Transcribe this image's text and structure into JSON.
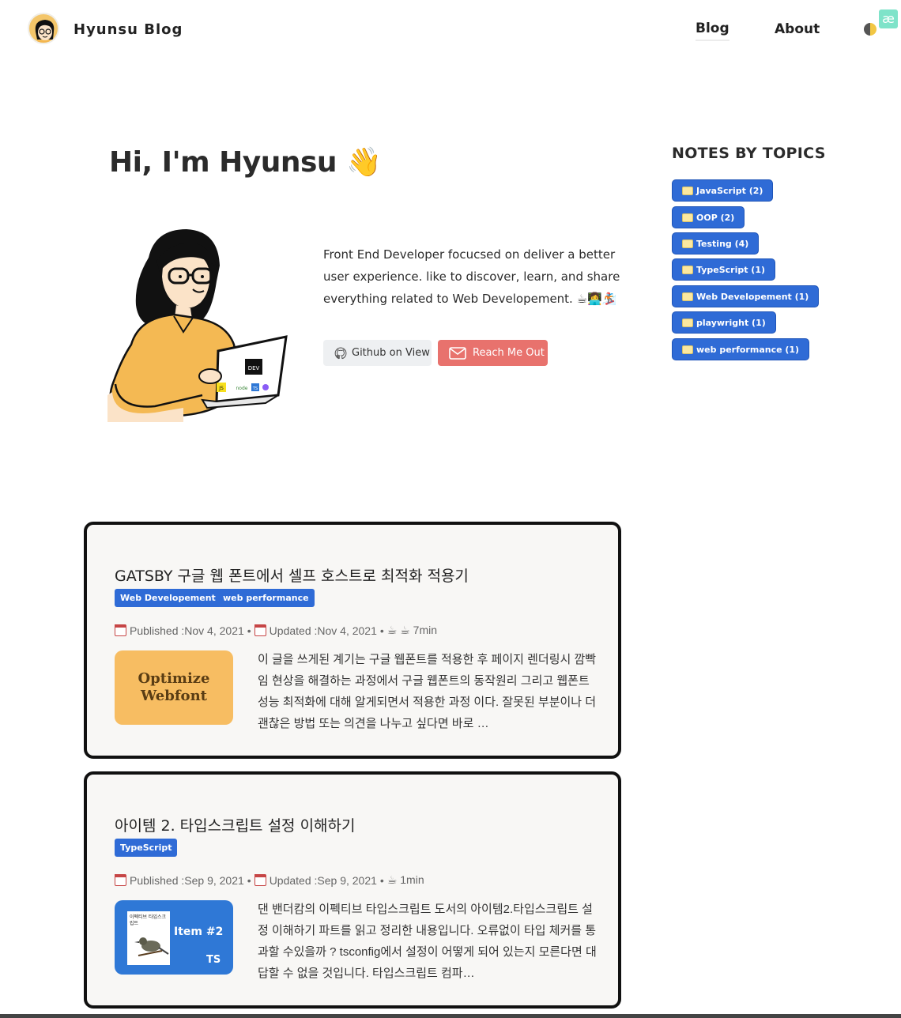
{
  "header": {
    "site_title": "Hyunsu Blog",
    "nav": {
      "blog": "Blog",
      "about": "About"
    },
    "ae_badge": "æ"
  },
  "hero": {
    "title": "Hi, I'm Hyunsu 👋",
    "bio": "Front End Developer focucsed on deliver a better user experience. like to discover, learn, and share everything related to Web Developement. ☕👩‍💻🏂",
    "github_button": "Github on View",
    "reach_button": "Reach Me Out",
    "laptop_sticker": "DEV",
    "laptop_logos": [
      "JS",
      "node",
      "TS"
    ]
  },
  "topics": {
    "title": "NOTES BY TOPICS",
    "items": [
      {
        "label": "JavaScript (2)"
      },
      {
        "label": "OOP (2)"
      },
      {
        "label": "Testing (4)"
      },
      {
        "label": "TypeScript (1)"
      },
      {
        "label": "Web Developement (1)"
      },
      {
        "label": "playwright (1)"
      },
      {
        "label": "web performance (1)"
      }
    ]
  },
  "posts": [
    {
      "title": "GATSBY 구글 웹 폰트에서 셀프 호스트로 최적화 적용기",
      "tags": [
        "Web Developement",
        "web performance"
      ],
      "published": "Published :Nov 4, 2021",
      "updated": "Updated :Nov 4, 2021",
      "reading": "☕ ☕  7min",
      "thumb_text": "Optimize Webfont",
      "excerpt": "이 글을 쓰게된 계기는 구글 웹폰트를 적용한 후 페이지 렌더링시 깜빡임 현상을 해결하는 과정에서 구글 웹폰트의 동작원리 그리고 웹폰트 성능 최적화에 대해 알게되면서 적용한 과정 이다. 잘못된 부분이나 더 괜찮은 방법 또는 의견을 나누고 싶다면 바로 …"
    },
    {
      "title": "아이템 2. 타입스크립트 설정 이해하기",
      "tags": [
        "TypeScript"
      ],
      "published": "Published :Sep 9, 2021",
      "updated": "Updated :Sep 9, 2021",
      "reading": "☕  1min",
      "thumb_text": "Item #2",
      "thumb_sub": "TS",
      "thumb_book": "이펙티브 타입스크립트",
      "excerpt": "댄 밴더캄의 이펙티브 타입스크립트 도서의 아이템2.타입스크립트 설정 이해하기 파트를 읽고 정리한 내용입니다. 오류없이 타입 체커를 통과할 수있을까 ? tsconfig에서 설정이 어떻게 되어 있는지 모른다면 대답할 수 없을 것입니다. 타입스크립트 컴파…"
    }
  ],
  "colors": {
    "tag_blue": "#2f6bd6",
    "reach_red": "#e8726d",
    "thumb_orange": "#f7bd62",
    "thumb_blue": "#2f78d6"
  }
}
